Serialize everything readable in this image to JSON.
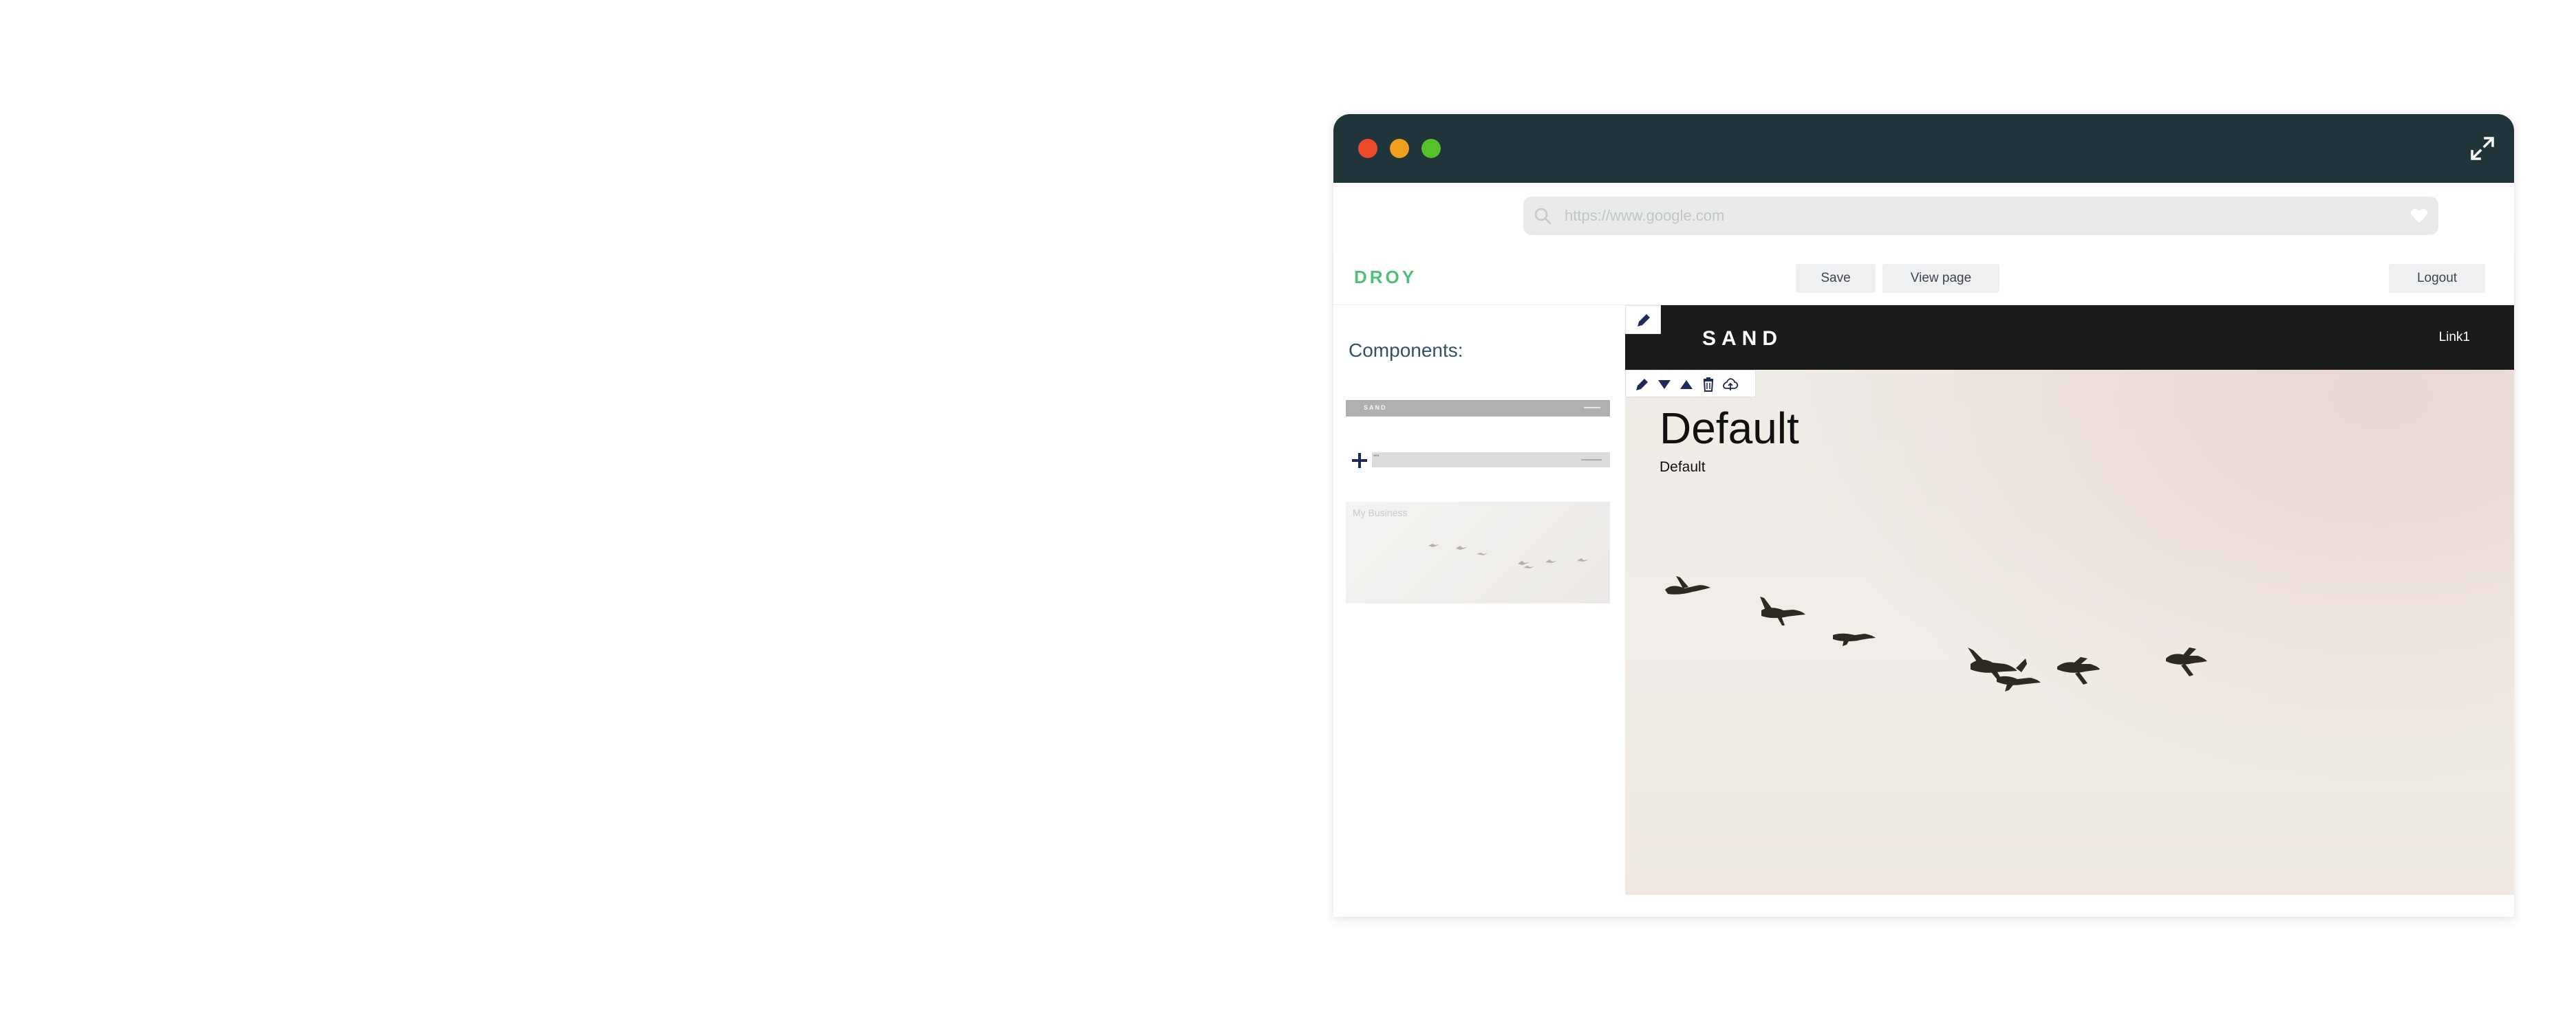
{
  "browser": {
    "url": "https://www.google.com"
  },
  "header": {
    "logo": "DROY",
    "save_label": "Save",
    "view_label": "View page",
    "logout_label": "Logout"
  },
  "sidebar": {
    "title": "Components:",
    "thumbnails": {
      "header_brand": "SAND",
      "nav_marks": "\"\"",
      "hero_title": "My Business"
    }
  },
  "site": {
    "brand": "SAND",
    "link": "Link1",
    "hero_title": "Default",
    "hero_subtitle": "Default"
  },
  "colors": {
    "titlebar": "#203539",
    "logo": "#4fbf7a",
    "site_header": "#1b1b1b",
    "accent_text": "#34506b"
  }
}
